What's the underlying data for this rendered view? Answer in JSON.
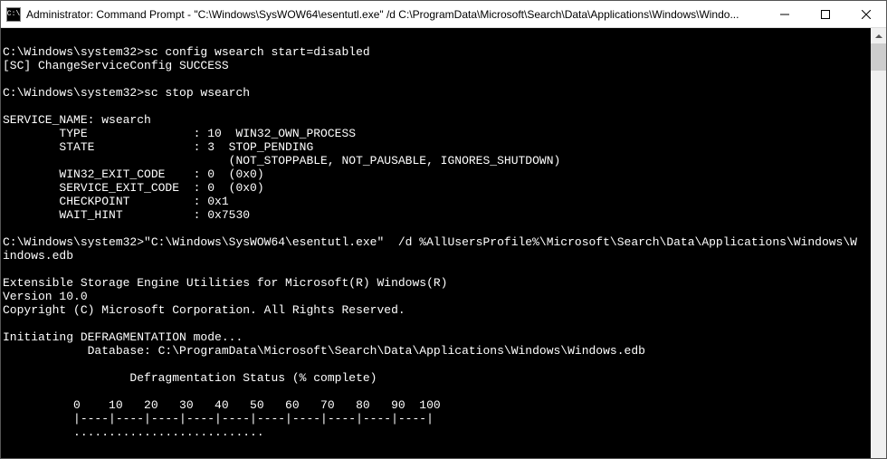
{
  "window": {
    "title": "Administrator: Command Prompt - \"C:\\Windows\\SysWOW64\\esentutl.exe\"  /d C:\\ProgramData\\Microsoft\\Search\\Data\\Applications\\Windows\\Windo...",
    "icon_label": "C:\\"
  },
  "terminal": {
    "lines": [
      "",
      "C:\\Windows\\system32>sc config wsearch start=disabled",
      "[SC] ChangeServiceConfig SUCCESS",
      "",
      "C:\\Windows\\system32>sc stop wsearch",
      "",
      "SERVICE_NAME: wsearch",
      "        TYPE               : 10  WIN32_OWN_PROCESS",
      "        STATE              : 3  STOP_PENDING",
      "                                (NOT_STOPPABLE, NOT_PAUSABLE, IGNORES_SHUTDOWN)",
      "        WIN32_EXIT_CODE    : 0  (0x0)",
      "        SERVICE_EXIT_CODE  : 0  (0x0)",
      "        CHECKPOINT         : 0x1",
      "        WAIT_HINT          : 0x7530",
      "",
      "C:\\Windows\\system32>\"C:\\Windows\\SysWOW64\\esentutl.exe\"  /d %AllUsersProfile%\\Microsoft\\Search\\Data\\Applications\\Windows\\W",
      "indows.edb",
      "",
      "Extensible Storage Engine Utilities for Microsoft(R) Windows(R)",
      "Version 10.0",
      "Copyright (C) Microsoft Corporation. All Rights Reserved.",
      "",
      "Initiating DEFRAGMENTATION mode...",
      "            Database: C:\\ProgramData\\Microsoft\\Search\\Data\\Applications\\Windows\\Windows.edb",
      "",
      "                  Defragmentation Status (% complete)",
      "",
      "          0    10   20   30   40   50   60   70   80   90  100",
      "          |----|----|----|----|----|----|----|----|----|----|",
      "          ..........................."
    ]
  }
}
